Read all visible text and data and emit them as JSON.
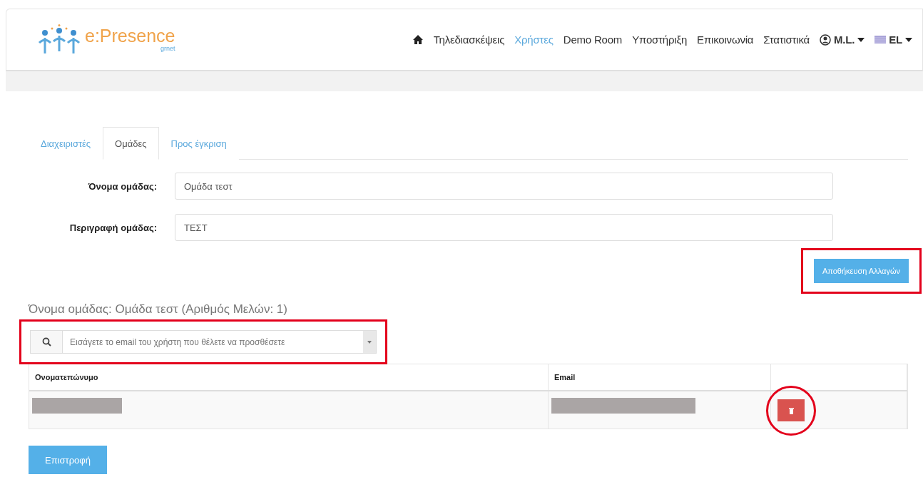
{
  "logo": {
    "name": "e:Presence",
    "sub": "grnet"
  },
  "nav": [
    {
      "kind": "icon",
      "selected": false
    },
    {
      "kind": "text",
      "label": "Τηλεδιασκέψεις",
      "selected": false
    },
    {
      "kind": "text",
      "label": "Χρήστες",
      "selected": true
    },
    {
      "kind": "text",
      "label": "Demo Room",
      "selected": false
    },
    {
      "kind": "text",
      "label": "Υποστήριξη",
      "selected": false
    },
    {
      "kind": "text",
      "label": "Επικοινωνία",
      "selected": false
    },
    {
      "kind": "text",
      "label": "Στατιστικά",
      "selected": false
    },
    {
      "kind": "user",
      "label": "M.L.",
      "selected": false
    },
    {
      "kind": "lang",
      "label": "EL",
      "selected": false
    }
  ],
  "tabs": [
    {
      "label": "Διαχειριστές",
      "selected": false
    },
    {
      "label": "Ομάδες",
      "selected": true
    },
    {
      "label": "Προς έγκριση",
      "selected": false
    }
  ],
  "form": [
    {
      "label": "Όνομα ομάδας:",
      "value": "Ομάδα τεστ"
    },
    {
      "label": "Περιγραφή ομάδας:",
      "value": "ΤΕΣΤ"
    }
  ],
  "save_button": {
    "label": "Αποθήκευση Αλλαγών",
    "highlighted": true
  },
  "group_heading": "Όνομα ομάδας: Ομάδα τεστ (Αριθμός Μελών: 1)",
  "member_search": {
    "placeholder": "Εισάγετε το email του χρήστη που θέλετε να προσθέσετε",
    "highlighted": true
  },
  "table": {
    "columns": [
      "Ονοματεπώνυμο",
      "Email"
    ],
    "rows": [
      {
        "name_redacted": true,
        "email_redacted": true,
        "delete_highlighted": true
      }
    ]
  },
  "back_button": "Επιστροφή"
}
